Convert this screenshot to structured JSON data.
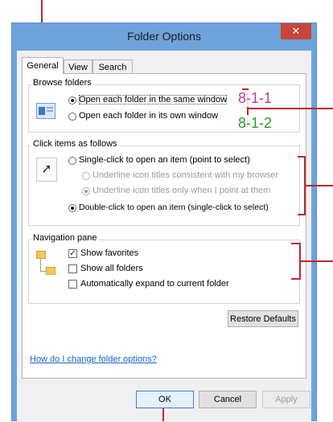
{
  "window": {
    "title": "Folder Options",
    "close_icon": "close-icon"
  },
  "tabs": [
    {
      "label": "General",
      "active": true
    },
    {
      "label": "View"
    },
    {
      "label": "Search"
    }
  ],
  "browse_folders": {
    "legend": "Browse folders",
    "option_same": "Open each folder in the same window",
    "option_own": "Open each folder in its own window",
    "selected": "same"
  },
  "click_items": {
    "legend": "Click items as follows",
    "option_single": "Single-click to open an item (point to select)",
    "sub_browser": "Underline icon titles consistent with my browser",
    "sub_point": "Underline icon titles only when I point at them",
    "option_double": "Double-click to open an item (single-click to select)",
    "selected": "double"
  },
  "navigation_pane": {
    "legend": "Navigation pane",
    "show_favorites": "Show favorites",
    "show_favorites_checked": true,
    "show_all_folders": "Show all folders",
    "show_all_folders_checked": false,
    "auto_expand": "Automatically expand to current folder",
    "auto_expand_checked": false
  },
  "restore_defaults": "Restore Defaults",
  "help_link": "How do I change folder options?",
  "buttons": {
    "ok": "OK",
    "cancel": "Cancel",
    "apply": "Apply"
  },
  "annotations": {
    "a1": "8-1-1",
    "a2": "8-1-2",
    "color1": "#c23b8a",
    "color2": "#2a9d2a",
    "bracket_color": "#c0262d"
  }
}
